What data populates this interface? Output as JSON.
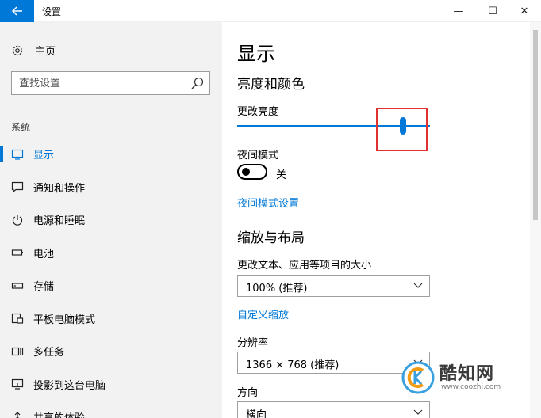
{
  "window": {
    "title": "设置",
    "back_icon": "arrow-left-icon",
    "minimize_glyph": "—",
    "maximize_glyph": "☐",
    "close_glyph": "✕"
  },
  "sidebar": {
    "home_label": "主页",
    "search_placeholder": "查找设置",
    "section_label": "系统",
    "items": [
      {
        "label": "显示",
        "icon": "monitor-icon",
        "active": true
      },
      {
        "label": "通知和操作",
        "icon": "message-icon",
        "active": false
      },
      {
        "label": "电源和睡眠",
        "icon": "power-icon",
        "active": false
      },
      {
        "label": "电池",
        "icon": "battery-icon",
        "active": false
      },
      {
        "label": "存储",
        "icon": "storage-icon",
        "active": false
      },
      {
        "label": "平板电脑模式",
        "icon": "tablet-icon",
        "active": false
      },
      {
        "label": "多任务",
        "icon": "multitask-icon",
        "active": false
      },
      {
        "label": "投影到这台电脑",
        "icon": "project-icon",
        "active": false
      },
      {
        "label": "共享的体验",
        "icon": "shared-icon",
        "active": false
      }
    ]
  },
  "main": {
    "title": "显示",
    "brightness_heading": "亮度和颜色",
    "brightness_label": "更改亮度",
    "brightness_value": 0.86,
    "night_mode_label": "夜间模式",
    "night_mode_state": "关",
    "night_mode_link": "夜间模式设置",
    "scale_heading": "缩放与布局",
    "scale_label": "更改文本、应用等项目的大小",
    "scale_value": "100% (推荐)",
    "custom_scale_link": "自定义缩放",
    "resolution_label": "分辨率",
    "resolution_value": "1366 × 768 (推荐)",
    "orientation_label": "方向",
    "orientation_value": "横向"
  },
  "watermark": {
    "title": "酷知网",
    "url": "www.coozhi.com"
  },
  "colors": {
    "accent": "#0078d7",
    "highlight": "#e0302f",
    "sidebar_bg": "#f2f2f2"
  }
}
